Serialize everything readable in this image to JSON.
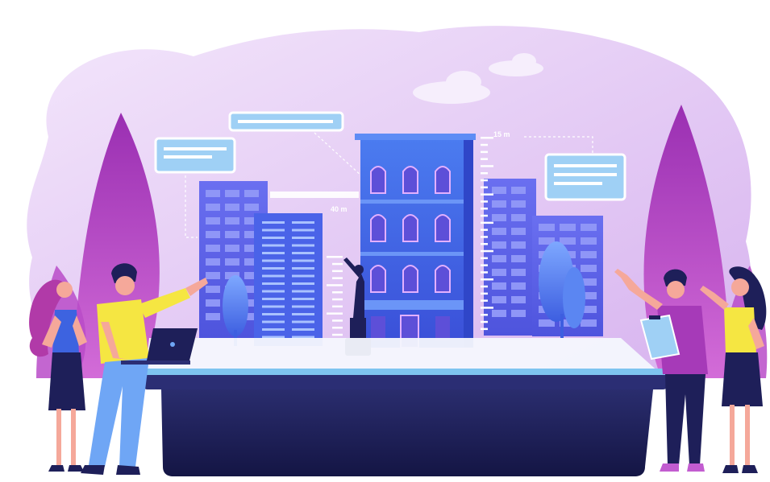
{
  "scene": {
    "height_marker_label": "15 m",
    "width_marker_label": "40 m"
  },
  "palette": {
    "blob_light": "#eadcf8",
    "blob_mid": "#d9b8f0",
    "leaf_dark": "#a63ab8",
    "leaf_light": "#c25cd0",
    "building_main": "#3f6ae8",
    "building_side": "#5a63e6",
    "platform_top": "#7ec4f0",
    "platform_base": "#1e1f59",
    "callout": "#9fd0f5"
  },
  "icons": [
    "cloud-icon",
    "laptop-icon",
    "clipboard-icon",
    "statue-icon",
    "tree-icon"
  ]
}
